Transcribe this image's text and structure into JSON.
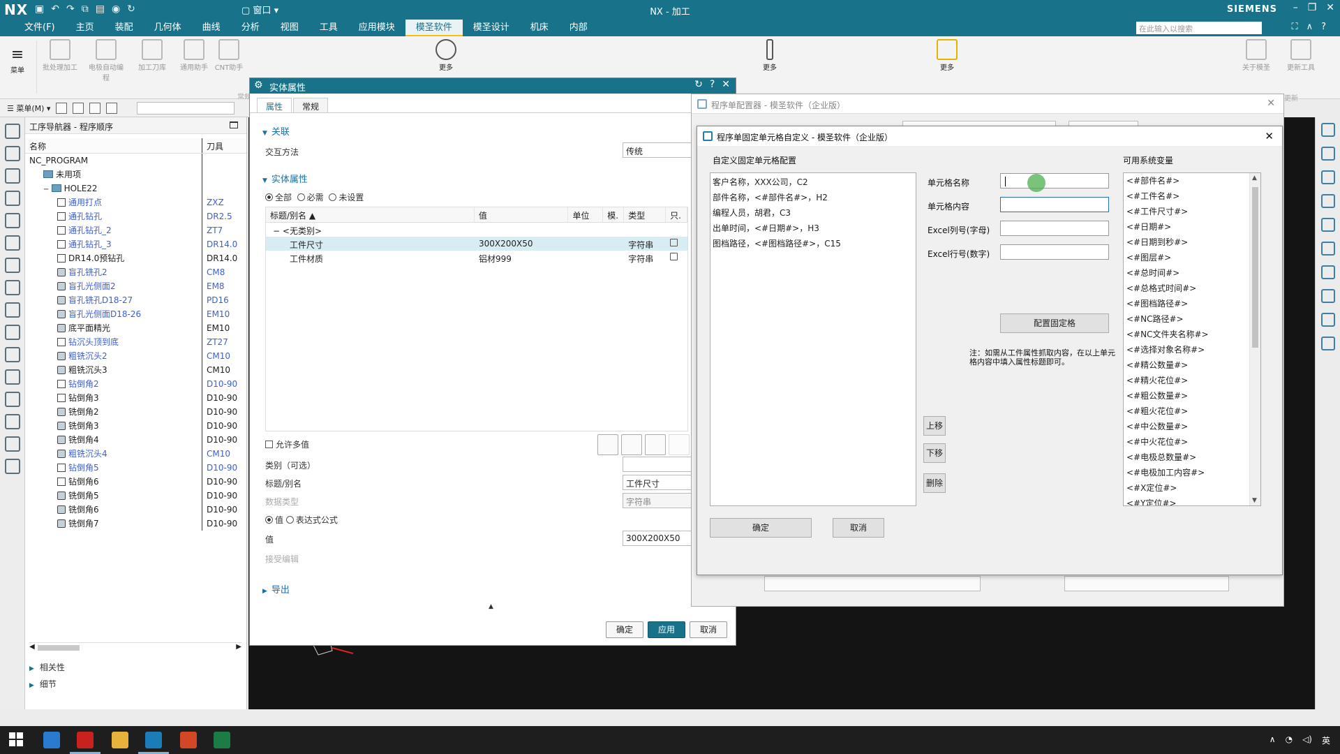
{
  "app": {
    "logo": "NX",
    "window_title": "NX - 加工",
    "brand": "SIEMENS",
    "window_menu": "窗口",
    "search_placeholder": "在此输入以搜索"
  },
  "menu": [
    "文件(F)",
    "主页",
    "装配",
    "几何体",
    "曲线",
    "分析",
    "视图",
    "工具",
    "应用模块",
    "模圣软件",
    "模圣设计",
    "机床",
    "内部"
  ],
  "menu_active": "模圣软件",
  "ribbon": {
    "menu_btn": "菜单",
    "more1": "更多",
    "more2": "更多",
    "more3": "更多",
    "labels": [
      "批处理加工",
      "电极自动编程",
      "加工刀库",
      "通用助手",
      "CNT助手"
    ],
    "right_labels": [
      "关于模圣",
      "更新工具"
    ],
    "group_left": "常规",
    "group_right": "更新"
  },
  "subtoolbar": {
    "menu_label": "菜单(M)"
  },
  "navigator": {
    "title": "工序导航器 - 程序顺序",
    "col_name": "名称",
    "col_tool": "刀具",
    "rows": [
      {
        "name": "NC_PROGRAM",
        "tool": "",
        "level": 0,
        "kind": "root",
        "blue": false
      },
      {
        "name": "未用项",
        "tool": "",
        "level": 1,
        "kind": "folder",
        "blue": false
      },
      {
        "name": "HOLE22",
        "tool": "",
        "level": 1,
        "kind": "folder",
        "blue": false
      },
      {
        "name": "通用打点",
        "tool": "ZXZ",
        "level": 2,
        "kind": "drill",
        "blue": true
      },
      {
        "name": "通孔钻孔",
        "tool": "DR2.5",
        "level": 2,
        "kind": "drill",
        "blue": true
      },
      {
        "name": "通孔钻孔_2",
        "tool": "ZT7",
        "level": 2,
        "kind": "drill",
        "blue": true
      },
      {
        "name": "通孔钻孔_3",
        "tool": "DR14.0",
        "level": 2,
        "kind": "drill",
        "blue": true
      },
      {
        "name": "DR14.0预钻孔",
        "tool": "DR14.0",
        "level": 2,
        "kind": "drill",
        "blue": false
      },
      {
        "name": "盲孔铣孔2",
        "tool": "CM8",
        "level": 2,
        "kind": "mill",
        "blue": true
      },
      {
        "name": "盲孔光侧面2",
        "tool": "EM8",
        "level": 2,
        "kind": "mill",
        "blue": true
      },
      {
        "name": "盲孔铣孔D18-27",
        "tool": "PD16",
        "level": 2,
        "kind": "mill",
        "blue": true
      },
      {
        "name": "盲孔光侧面D18-26",
        "tool": "EM10",
        "level": 2,
        "kind": "mill",
        "blue": true
      },
      {
        "name": "底平面精光",
        "tool": "EM10",
        "level": 2,
        "kind": "mill",
        "blue": false
      },
      {
        "name": "钻沉头顶到底",
        "tool": "ZT27",
        "level": 2,
        "kind": "drill",
        "blue": true
      },
      {
        "name": "粗铣沉头2",
        "tool": "CM10",
        "level": 2,
        "kind": "mill",
        "blue": true
      },
      {
        "name": "粗铣沉头3",
        "tool": "CM10",
        "level": 2,
        "kind": "mill",
        "blue": false
      },
      {
        "name": "钻倒角2",
        "tool": "D10-90",
        "level": 2,
        "kind": "drill",
        "blue": true
      },
      {
        "name": "钻倒角3",
        "tool": "D10-90",
        "level": 2,
        "kind": "drill",
        "blue": false
      },
      {
        "name": "铣倒角2",
        "tool": "D10-90",
        "level": 2,
        "kind": "mill",
        "blue": false
      },
      {
        "name": "铣倒角3",
        "tool": "D10-90",
        "level": 2,
        "kind": "mill",
        "blue": false
      },
      {
        "name": "铣倒角4",
        "tool": "D10-90",
        "level": 2,
        "kind": "mill",
        "blue": false
      },
      {
        "name": "粗铣沉头4",
        "tool": "CM10",
        "level": 2,
        "kind": "mill",
        "blue": true
      },
      {
        "name": "钻倒角5",
        "tool": "D10-90",
        "level": 2,
        "kind": "drill",
        "blue": true
      },
      {
        "name": "钻倒角6",
        "tool": "D10-90",
        "level": 2,
        "kind": "drill",
        "blue": false
      },
      {
        "name": "铣倒角5",
        "tool": "D10-90",
        "level": 2,
        "kind": "mill",
        "blue": false
      },
      {
        "name": "铣倒角6",
        "tool": "D10-90",
        "level": 2,
        "kind": "mill",
        "blue": false
      },
      {
        "name": "铣倒角7",
        "tool": "D10-90",
        "level": 2,
        "kind": "mill",
        "blue": false
      }
    ],
    "section_related": "相关性",
    "section_details": "细节"
  },
  "entity_dialog": {
    "title": "实体属性",
    "tabs": [
      "属性",
      "常规"
    ],
    "active_tab": "属性",
    "group_assoc": "关联",
    "interaction_label": "交互方法",
    "interaction_value": "传统",
    "group_props": "实体属性",
    "filter_options": [
      "全部",
      "必需",
      "未设置"
    ],
    "filter_selected": "全部",
    "table_headers": [
      "标题/别名",
      "值",
      "单位",
      "模.",
      "类型",
      "只."
    ],
    "table_group": "<无类别>",
    "table_rows": [
      {
        "title": "工件尺寸",
        "value": "300X200X50",
        "unit": "",
        "type": "字符串",
        "selected": true
      },
      {
        "title": "工件材质",
        "value": "铝材999",
        "unit": "",
        "type": "字符串",
        "selected": false
      }
    ],
    "allow_multi": "允许多值",
    "category_label": "类别（可选）",
    "title_label": "标题/别名",
    "title_value": "工件尺寸",
    "datatype_label": "数据类型",
    "datatype_value": "字符串",
    "value_mode_options": [
      "值",
      "表达式公式"
    ],
    "value_mode_selected": "值",
    "value_label": "值",
    "value_value": "300X200X50",
    "edit_label": "接受编辑",
    "export_group": "导出",
    "btn_ok": "确定",
    "btn_apply": "应用",
    "btn_cancel": "取消"
  },
  "config_dialog": {
    "title": "程序单配置器 - 模圣软件（企业版）"
  },
  "cell_dialog": {
    "title": "程序单固定单元格自定义 - 模圣软件（企业版）",
    "left_label": "自定义固定单元格配置",
    "config_items": [
      "客户名称，XXX公司，C2",
      "部件名称，<#部件名#>，H2",
      "编程人员，胡君，C3",
      "出单时间，<#日期#>，H3",
      "图档路径，<#图档路径#>，C15"
    ],
    "cell_name_label": "单元格名称",
    "cell_content_label": "单元格内容",
    "excel_col_label": "Excel列号(字母)",
    "excel_row_label": "Excel行号(数字)",
    "cell_name_value": "",
    "cell_content_value": "",
    "excel_col_value": "",
    "excel_row_value": "",
    "config_btn": "配置固定格",
    "note": "注：如需从工件属性抓取内容，在以上单元格内容中填入属性标题即可。",
    "btn_up": "上移",
    "btn_down": "下移",
    "btn_delete": "删除",
    "btn_ok": "确定",
    "btn_cancel": "取消",
    "vars_label": "可用系统变量",
    "vars": [
      "<#部件名#>",
      "<#工件名#>",
      "<#工件尺寸#>",
      "<#日期#>",
      "<#日期到秒#>",
      "<#图层#>",
      "<#总时间#>",
      "<#总格式时间#>",
      "<#图档路径#>",
      "<#NC路径#>",
      "<#NC文件夹名称#>",
      "<#选择对象名称#>",
      "<#精公数量#>",
      "<#精火花位#>",
      "<#粗公数量#>",
      "<#粗火花位#>",
      "<#中公数量#>",
      "<#中火花位#>",
      "<#电极总数量#>",
      "<#电极加工内容#>",
      "<#X定位#>",
      "<#Y定位#>"
    ]
  },
  "taskbar": {
    "tray_lang": "英"
  },
  "colors": {
    "nx_teal": "#18738a",
    "link_blue": "#3d5fd1",
    "cursor_green": "#4caf50"
  }
}
